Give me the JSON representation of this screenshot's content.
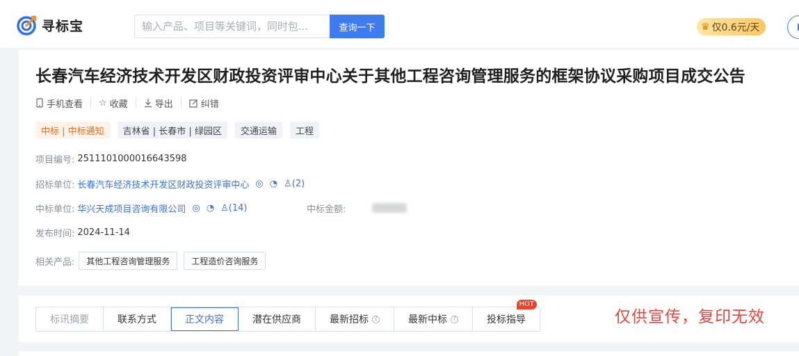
{
  "header": {
    "logo_text": "寻标宝",
    "search_placeholder": "输入产品、项目等关键词，同时包...",
    "search_button": "查询一下",
    "vip_price": "仅0.6元/天"
  },
  "notice": {
    "title": "长春汽车经济技术开发区财政投资评审中心关于其他工程咨询管理服务的框架协议采购项目成交公告",
    "actions": [
      {
        "icon": "phone-icon",
        "label": "手机查看"
      },
      {
        "icon": "star-icon",
        "label": "收藏"
      },
      {
        "icon": "download-icon",
        "label": "导出"
      },
      {
        "icon": "edit-icon",
        "label": "纠错"
      }
    ],
    "tags": [
      "中标 | 中标通知",
      "吉林省 | 长春市 | 绿园区",
      "交通运输",
      "工程"
    ],
    "project_no_label": "项目编号:",
    "project_no": "2511101000016643598",
    "tenderer_label": "招标单位:",
    "tenderer": "长春汽车经济技术开发区财政投资评审中心",
    "tenderer_contacts": "(2)",
    "winner_label": "中标单位:",
    "winner": "华兴天成项目咨询有限公司",
    "winner_contacts": "(14)",
    "amount_label": "中标金额:",
    "publish_label": "发布时间:",
    "publish_date": "2024-11-14",
    "products_label": "相关产品:",
    "products": [
      "其他工程咨询管理服务",
      "工程造价咨询服务"
    ]
  },
  "tabs": [
    {
      "label": "标讯摘要",
      "state": "disabled"
    },
    {
      "label": "联系方式",
      "state": "normal"
    },
    {
      "label": "正文内容",
      "state": "active"
    },
    {
      "label": "潜在供应商",
      "state": "normal"
    },
    {
      "label": "最新招标",
      "state": "normal",
      "help": "?"
    },
    {
      "label": "最新中标",
      "state": "normal",
      "help": "?"
    },
    {
      "label": "投标指导",
      "state": "normal",
      "badge": "HOT"
    }
  ],
  "watermark": "仅供宣传，复印无效",
  "colors": {
    "accent": "#3f7cf0",
    "link": "#3b73d8",
    "tag_orange": "#f06b1d",
    "watermark": "#e8453c"
  }
}
